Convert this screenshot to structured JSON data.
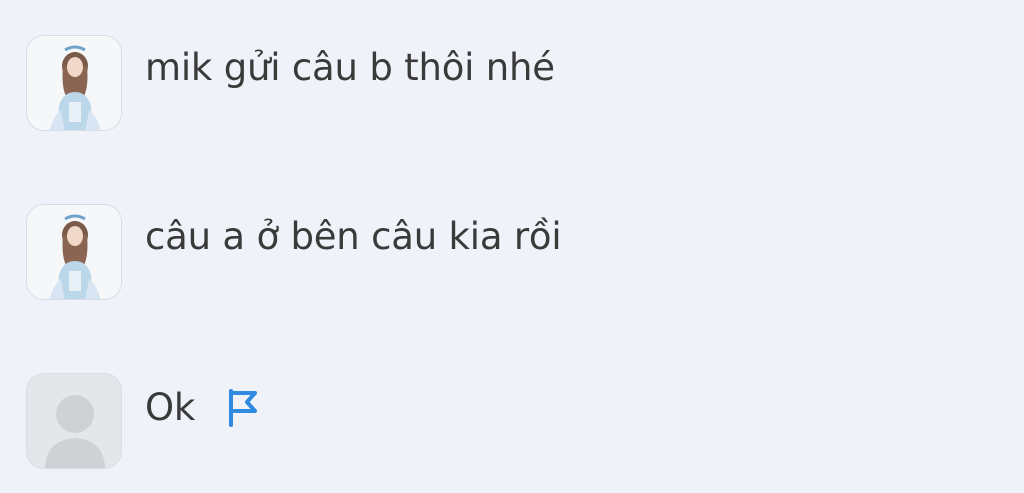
{
  "comments": [
    {
      "text": "mik gửi câu b thôi nhé",
      "avatar": "user-photo-avatar"
    },
    {
      "text": "câu a ở bên câu kia rồi",
      "avatar": "user-photo-avatar"
    },
    {
      "text": "Ok",
      "avatar": "default-avatar",
      "action_icon": "flag-icon"
    }
  ],
  "colors": {
    "background": "#eff3f9",
    "text": "#3a3a3a",
    "flag": "#2f8ae0",
    "default_avatar_bg": "#e4e6ea",
    "default_avatar_silhouette": "#cfd1d5"
  }
}
